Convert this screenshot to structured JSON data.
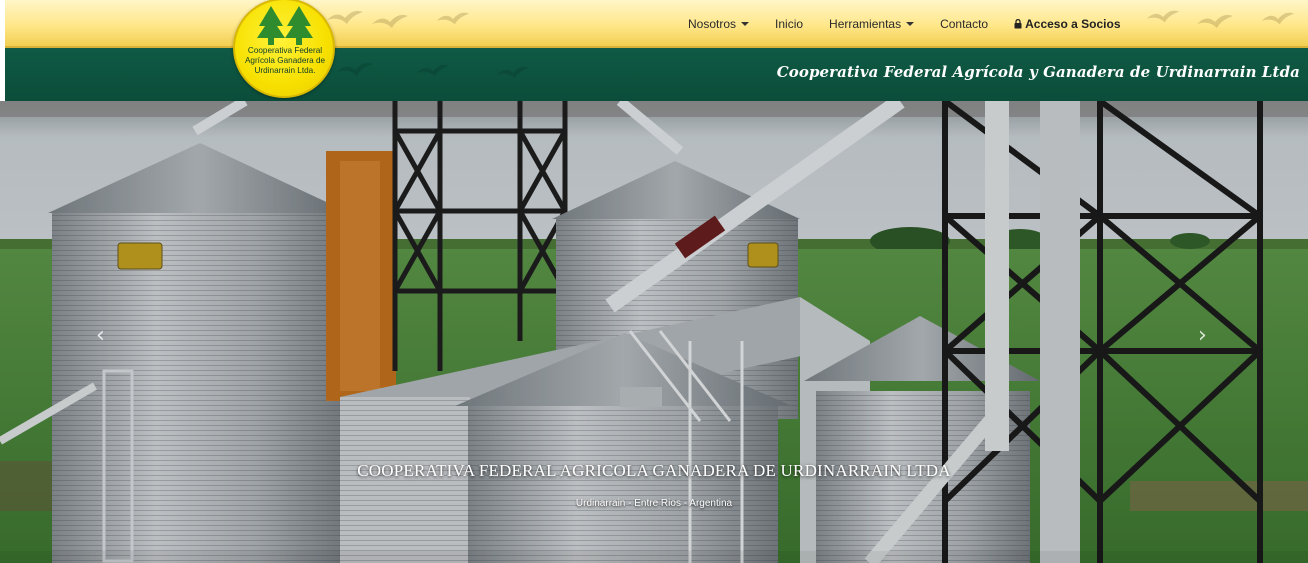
{
  "logo": {
    "line1": "Cooperativa Federal",
    "line2": "Agrícola Ganadera de",
    "line3": "Urdinarrain Ltda."
  },
  "nav": {
    "items": [
      {
        "label": "Nosotros",
        "dropdown": true
      },
      {
        "label": "Inicio",
        "dropdown": false
      },
      {
        "label": "Herramientas",
        "dropdown": true
      },
      {
        "label": "Contacto",
        "dropdown": false
      },
      {
        "label": "Acceso a Socios",
        "dropdown": false,
        "icon": "lock-icon"
      }
    ]
  },
  "header": {
    "tagline": "Cooperativa Federal Agrícola y Ganadera de Urdinarrain Ltda"
  },
  "hero": {
    "title": "COOPERATIVA FEDERAL AGRICOLA GANADERA DE URDINARRAIN LTDA",
    "subtitle": "Urdinarrain - Entre Rios - Argentina",
    "prev_icon": "chevron-left-icon",
    "next_icon": "chevron-right-icon"
  },
  "colors": {
    "topbar": "#ffe78a",
    "greenbar": "#0b4d3a",
    "logo": "#f7e000",
    "tree": "#2e8b2e"
  }
}
